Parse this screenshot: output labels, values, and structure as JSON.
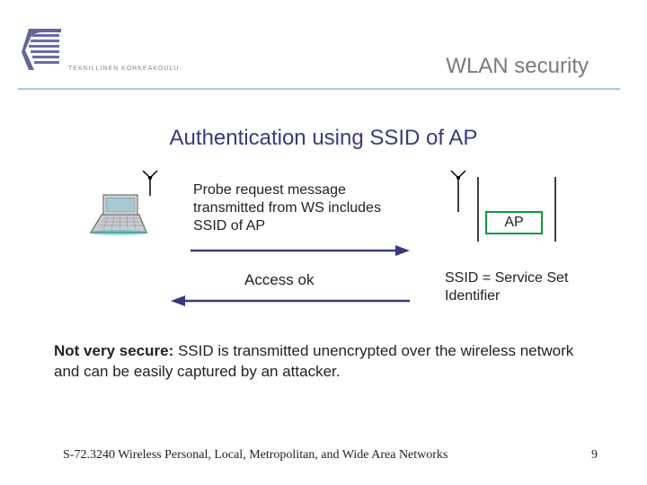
{
  "header": {
    "subtitle": "TEKNILLINEN KORKEAKOULU",
    "title": "WLAN security"
  },
  "slide": {
    "title": "Authentication using SSID of AP"
  },
  "diagram": {
    "probe_text": "Probe request message transmitted from WS includes SSID of AP",
    "ap_label": "AP",
    "access_text": "Access ok",
    "ssid_text": "SSID = Service Set Identifier"
  },
  "note": {
    "lead": "Not very secure: ",
    "body": "SSID is transmitted unencrypted over the wireless network and can be easily captured by an attacker."
  },
  "footer": {
    "course": "S-72.3240 Wireless Personal, Local, Metropolitan, and Wide Area Networks",
    "page": "9"
  },
  "icons": {
    "logo": "tkk-logo",
    "laptop": "laptop-icon",
    "antenna": "antenna-icon",
    "arrow_right": "arrow-right-icon",
    "arrow_left": "arrow-left-icon"
  }
}
